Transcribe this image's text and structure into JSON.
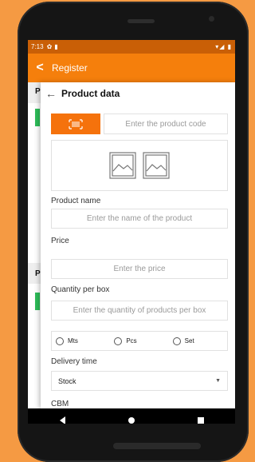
{
  "status": {
    "time": "7:13",
    "icons": "▾◢ ▮"
  },
  "appbar": {
    "back_icon": "<",
    "title": "Register"
  },
  "behind": {
    "label_a": "P",
    "label_b": "P"
  },
  "dialog": {
    "back_icon": "←",
    "title": "Product data",
    "code_placeholder": "Enter the product code",
    "scan_icon": "barcode-icon",
    "product_name_label": "Product name",
    "product_name_placeholder": "Enter the name of the product",
    "price_label": "Price",
    "price_placeholder": "Enter the price",
    "quantity_label": "Quantity per box",
    "quantity_placeholder": "Enter the quantity of products per box",
    "units": [
      "Mts",
      "Pcs",
      "Set"
    ],
    "delivery_label": "Delivery time",
    "delivery_value": "Stock",
    "cbm_label": "CBM"
  },
  "colors": {
    "accent": "#f57f0c",
    "status": "#c95f06",
    "green": "#2ebd59",
    "background": "#f59a43"
  }
}
